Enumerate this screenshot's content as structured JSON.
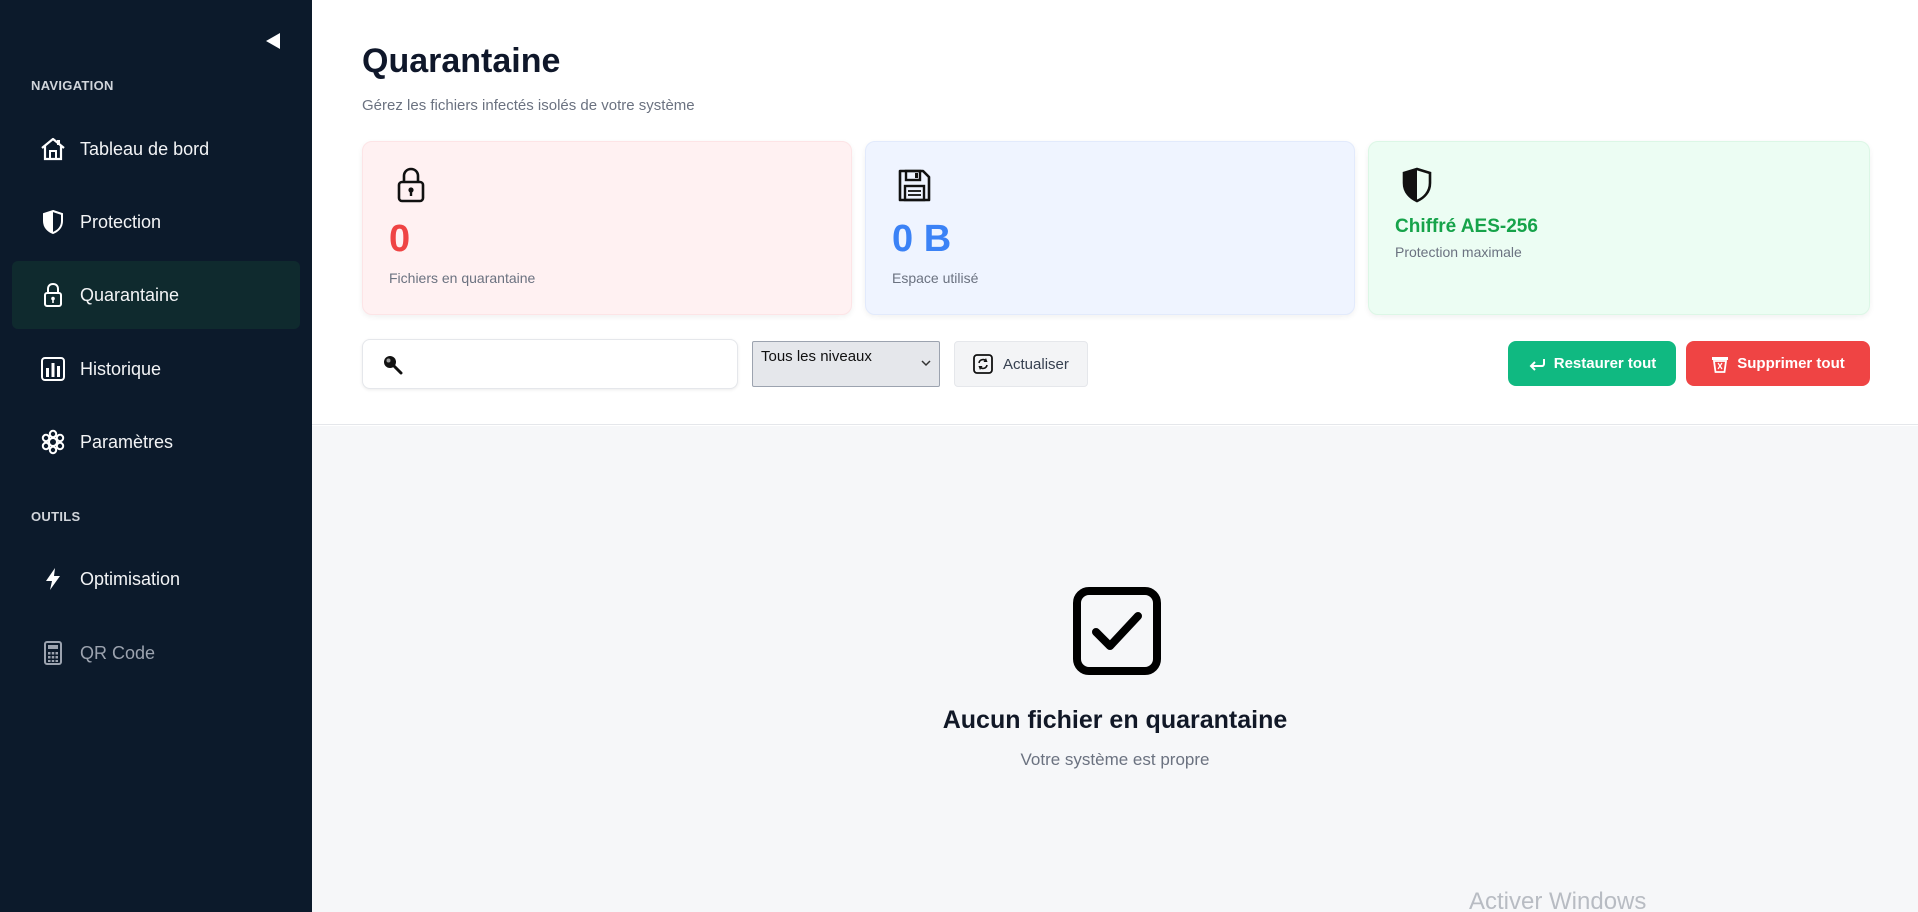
{
  "sidebar": {
    "sections": {
      "navigation": "NAVIGATION",
      "tools": "OUTILS"
    },
    "items": [
      {
        "label": "Tableau de bord",
        "icon": "house-icon"
      },
      {
        "label": "Protection",
        "icon": "shield-icon"
      },
      {
        "label": "Quarantaine",
        "icon": "lock-icon",
        "active": true
      },
      {
        "label": "Historique",
        "icon": "bar-chart-icon"
      },
      {
        "label": "Paramètres",
        "icon": "gear-icon"
      }
    ],
    "tools": [
      {
        "label": "Optimisation",
        "icon": "lightning-icon"
      },
      {
        "label": "QR Code",
        "icon": "calculator-icon"
      }
    ]
  },
  "header": {
    "title": "Quarantaine",
    "subtitle": "Gérez les fichiers infectés isolés de votre système"
  },
  "stats": {
    "files": {
      "value": "0",
      "label": "Fichiers en quarantaine",
      "color": "#ef4444"
    },
    "space": {
      "value": "0 B",
      "label": "Espace utilisé",
      "color": "#3b82f6"
    },
    "encryption": {
      "title": "Chiffré AES-256",
      "label": "Protection maximale",
      "color": "#16a34a"
    }
  },
  "toolbar": {
    "search_placeholder": "",
    "filter_selected": "Tous les niveaux",
    "refresh_label": "Actualiser",
    "restore_label": "Restaurer tout",
    "delete_label": "Supprimer tout"
  },
  "empty_state": {
    "title": "Aucun fichier en quarantaine",
    "subtitle": "Votre système est propre"
  },
  "watermark": "Activer Windows",
  "colors": {
    "sidebar_bg": "#0c1a2b",
    "accent_green": "#10b981",
    "accent_red": "#ef4444"
  }
}
